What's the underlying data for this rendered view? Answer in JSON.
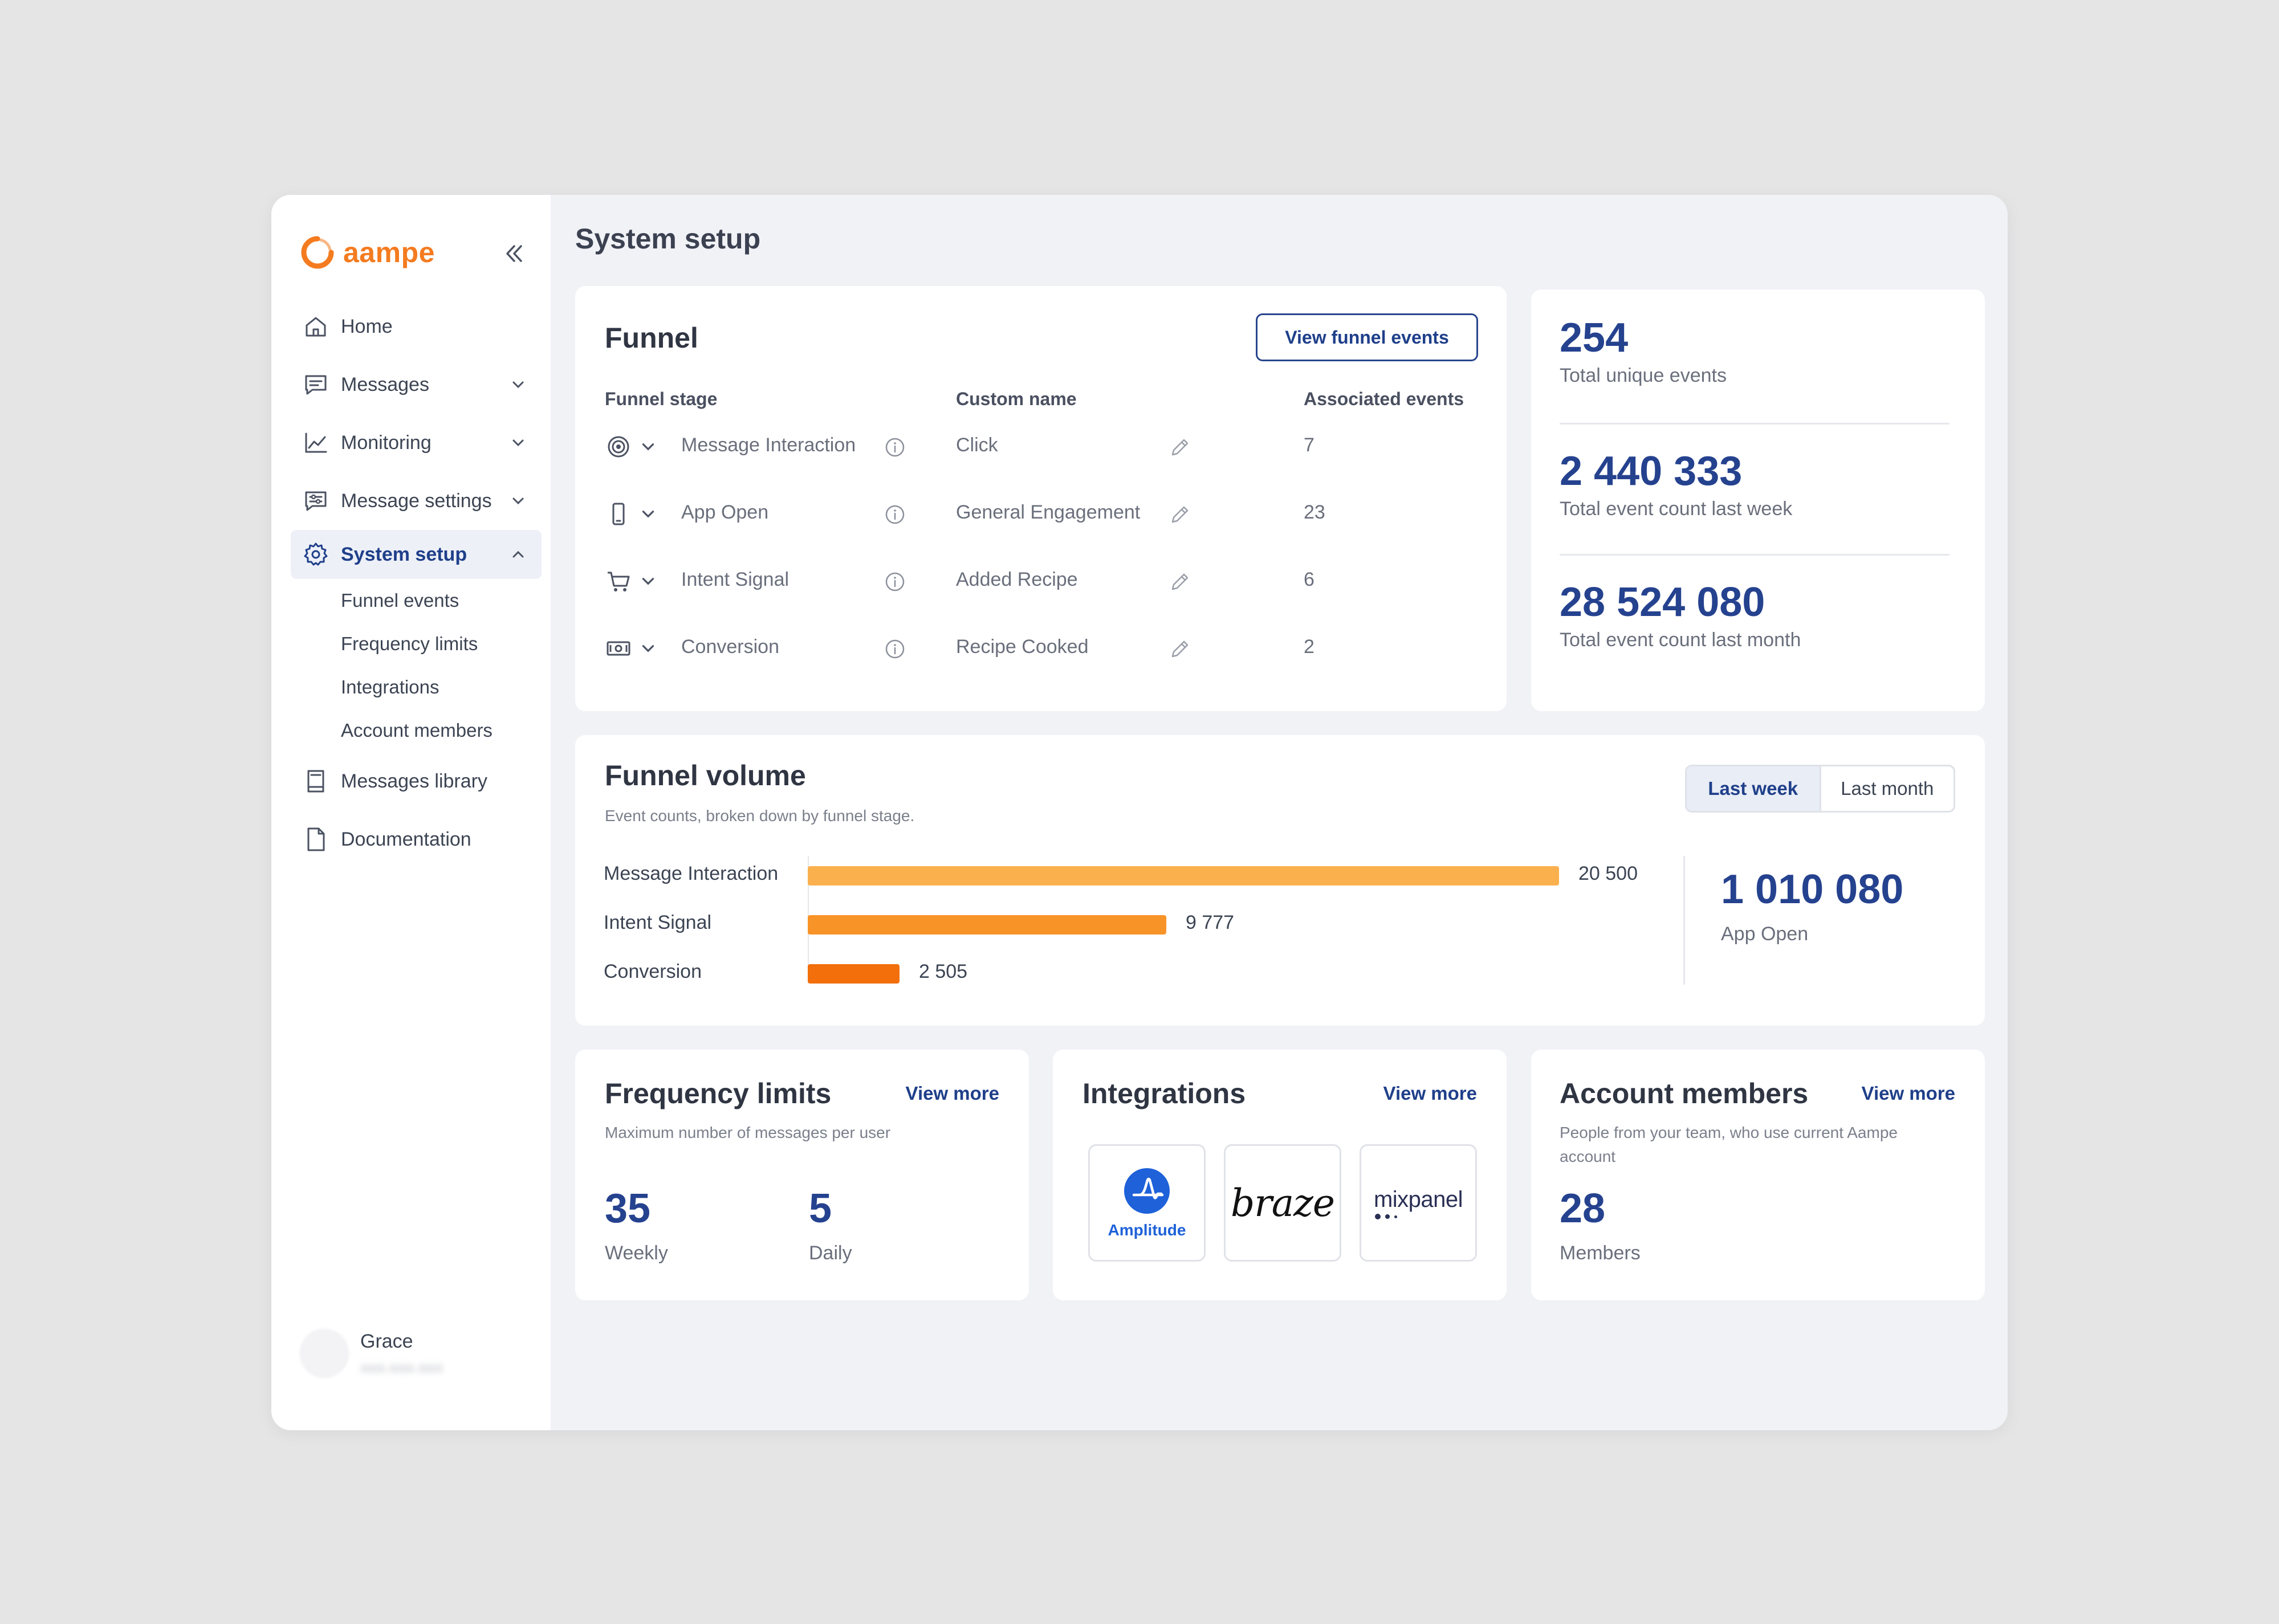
{
  "app": {
    "name": "aampe",
    "brand_color": "#f47b20",
    "accent_color": "#25428f"
  },
  "nav": {
    "items": [
      {
        "label": "Home",
        "icon": "home-icon"
      },
      {
        "label": "Messages",
        "icon": "chat-icon"
      },
      {
        "label": "Monitoring",
        "icon": "chart-line-icon"
      },
      {
        "label": "Message settings",
        "icon": "message-settings-icon"
      },
      {
        "label": "System setup",
        "icon": "gear-icon",
        "active": true
      }
    ],
    "sub_items": [
      "Funnel events",
      "Frequency limits",
      "Integrations",
      "Account members"
    ],
    "bottom_items": [
      {
        "label": "Messages library",
        "icon": "book-icon"
      },
      {
        "label": "Documentation",
        "icon": "document-icon"
      }
    ]
  },
  "user": {
    "name": "Grace",
    "email": "aaa.aaa.aaa"
  },
  "page": {
    "title": "System setup"
  },
  "funnel": {
    "title": "Funnel",
    "button": "View funnel events",
    "headers": {
      "stage": "Funnel stage",
      "custom": "Custom name",
      "events": "Associated events"
    },
    "rows": [
      {
        "icon": "target-icon",
        "stage": "Message Interaction",
        "custom": "Click",
        "events": "7"
      },
      {
        "icon": "phone-icon",
        "stage": "App Open",
        "custom": "General Engagement",
        "events": "23"
      },
      {
        "icon": "cart-icon",
        "stage": "Intent Signal",
        "custom": "Added Recipe",
        "events": "6"
      },
      {
        "icon": "cash-icon",
        "stage": "Conversion",
        "custom": "Recipe Cooked",
        "events": "2"
      }
    ]
  },
  "stats": [
    {
      "value": "254",
      "label": "Total unique events"
    },
    {
      "value": "2 440 333",
      "label": "Total event count last week"
    },
    {
      "value": "28 524 080",
      "label": "Total event count last month"
    }
  ],
  "volume": {
    "title": "Funnel volume",
    "subtitle": "Event counts, broken down by funnel stage.",
    "toggle": [
      "Last week",
      "Last month"
    ],
    "side_value": "1 010 080",
    "side_label": "App Open"
  },
  "chart_data": {
    "type": "bar",
    "orientation": "horizontal",
    "categories": [
      "Message Interaction",
      "Intent Signal",
      "Conversion"
    ],
    "values": [
      20500,
      9777,
      2505
    ],
    "value_labels": [
      "20 500",
      "9 777",
      "2 505"
    ],
    "colors": [
      "#fbb04e",
      "#f89327",
      "#f26f0b"
    ]
  },
  "frequency": {
    "title": "Frequency limits",
    "view_more": "View more",
    "subtitle": "Maximum number of messages per user",
    "weekly_value": "35",
    "weekly_label": "Weekly",
    "daily_value": "5",
    "daily_label": "Daily"
  },
  "integrations": {
    "title": "Integrations",
    "view_more": "View more",
    "logos": [
      {
        "name": "Amplitude",
        "icon": "amplitude-logo"
      },
      {
        "name": "braze",
        "icon": "braze-logo"
      },
      {
        "name": "mixpanel",
        "icon": "mixpanel-logo"
      }
    ]
  },
  "account": {
    "title": "Account members",
    "view_more": "View more",
    "subtitle_line1": "People from your team, who use current Aampe",
    "subtitle_line2": "account",
    "value": "28",
    "label": "Members"
  }
}
